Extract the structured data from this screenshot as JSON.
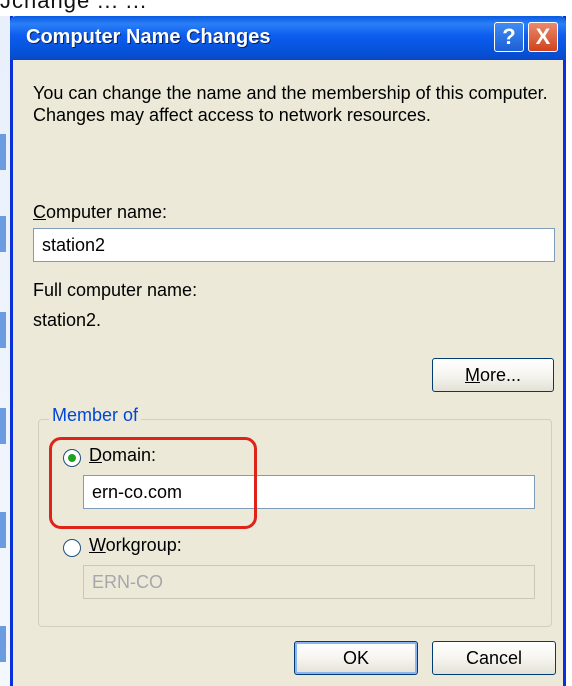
{
  "background": {
    "top_fragment": "Jchange    ...  ..."
  },
  "dialog": {
    "title": "Computer Name Changes",
    "help_button": "?",
    "close_button": "X",
    "description": "You can change the name and the membership of this computer. Changes may affect access to network resources.",
    "computer_name": {
      "label_access_key": "C",
      "label_rest": "omputer name:",
      "value": "station2"
    },
    "full_computer_name": {
      "label": "Full computer name:",
      "value": "station2."
    },
    "more_button": {
      "access_key": "M",
      "rest": "ore..."
    },
    "member_of": {
      "legend": "Member of",
      "domain": {
        "label_access_key": "D",
        "label_rest": "omain:",
        "selected": true,
        "value": "ern-co.com"
      },
      "workgroup": {
        "label_access_key": "W",
        "label_rest": "orkgroup:",
        "selected": false,
        "value": "ERN-CO"
      }
    },
    "ok_button": "OK",
    "cancel_button": "Cancel"
  },
  "colors": {
    "titlebar": "#0c5cf0",
    "dialog_bg": "#ece9d8",
    "highlight": "#e0231a",
    "group_legend": "#0046d5"
  }
}
